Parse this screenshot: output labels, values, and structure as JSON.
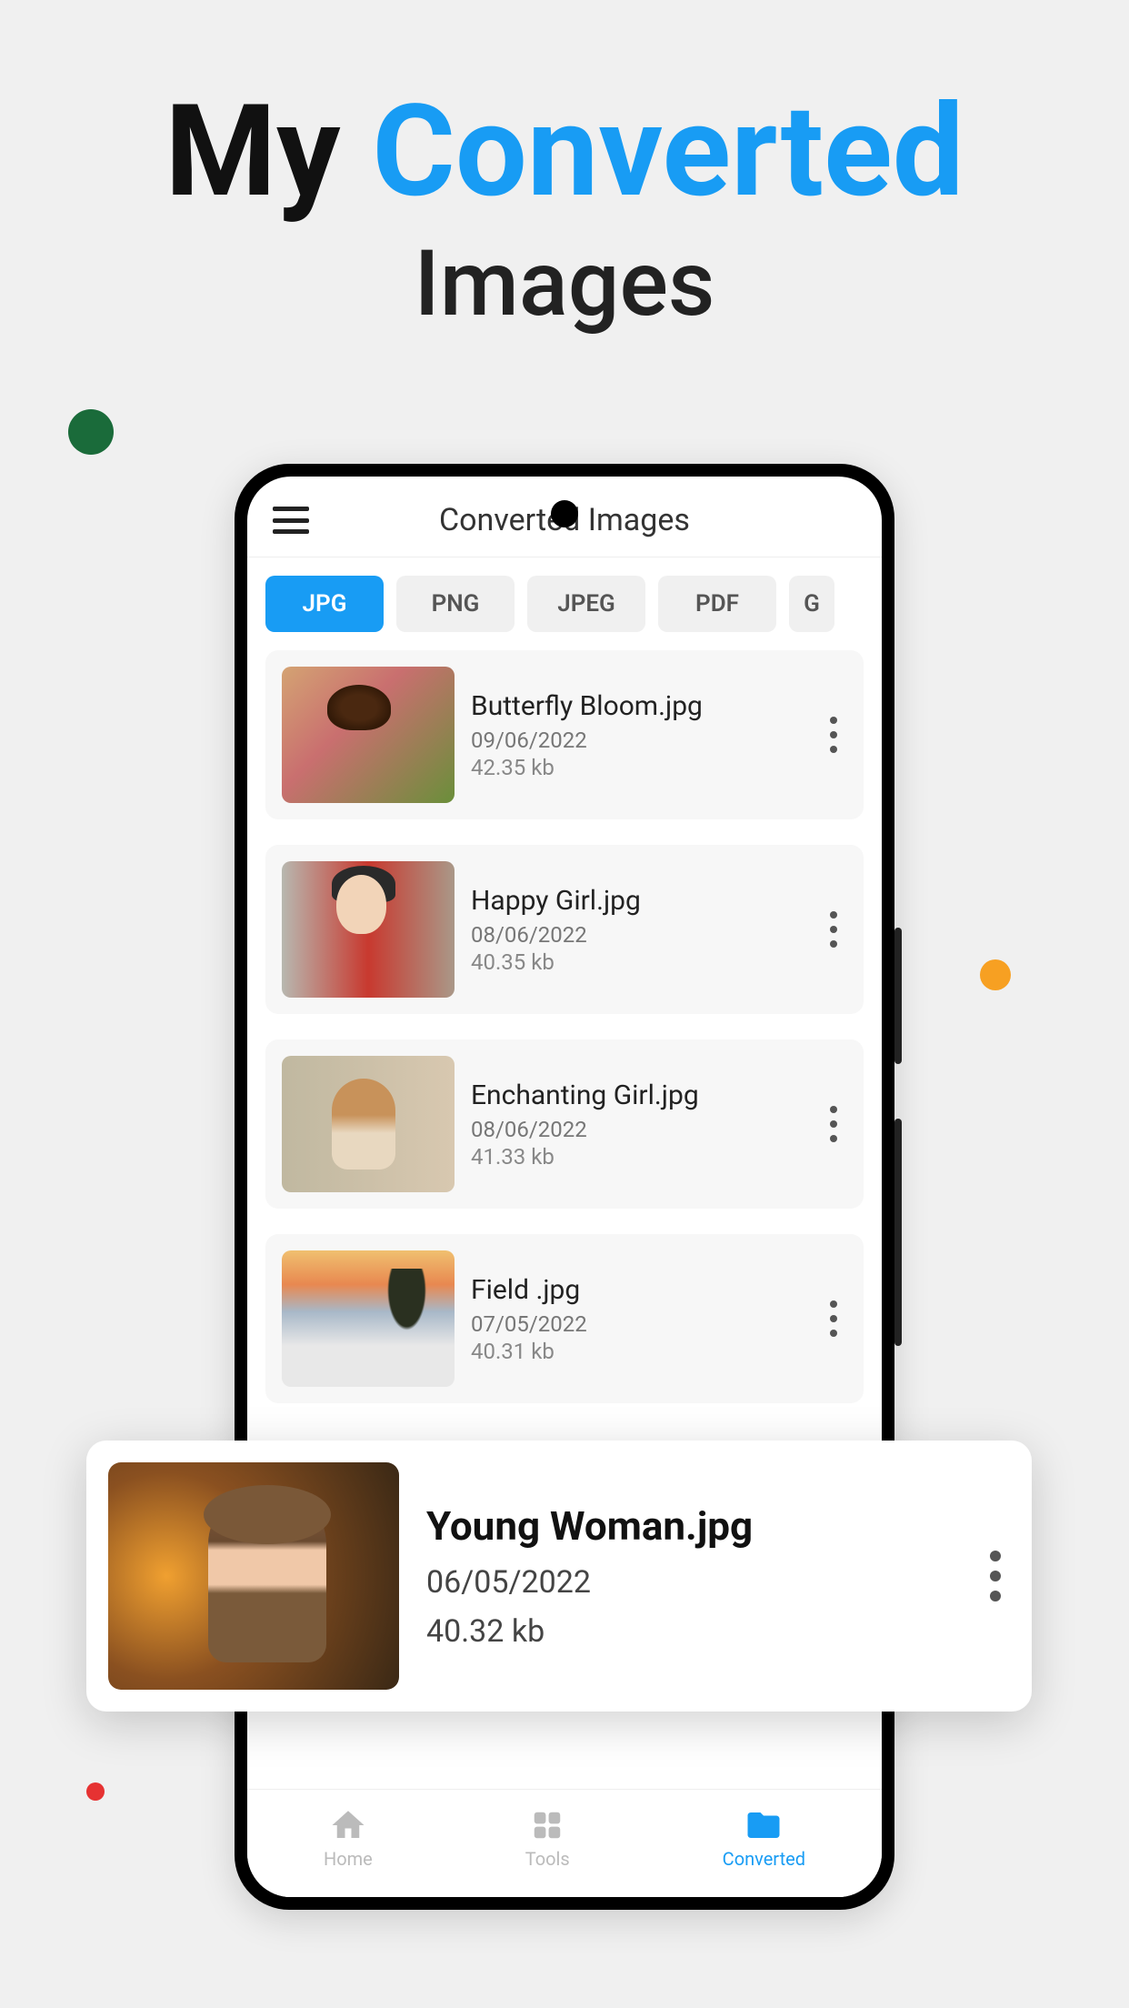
{
  "hero": {
    "word1": "My",
    "word2": "Converted",
    "line2": "Images"
  },
  "app": {
    "title": "Converted Images"
  },
  "filters": [
    {
      "label": "JPG",
      "active": true
    },
    {
      "label": "PNG",
      "active": false
    },
    {
      "label": "JPEG",
      "active": false
    },
    {
      "label": "PDF",
      "active": false
    },
    {
      "label": "G",
      "active": false
    }
  ],
  "files": [
    {
      "name": "Butterfly Bloom.jpg",
      "date": "09/06/2022",
      "size": "42.35 kb",
      "thumb": "butterfly"
    },
    {
      "name": "Happy Girl.jpg",
      "date": "08/06/2022",
      "size": "40.35 kb",
      "thumb": "happy"
    },
    {
      "name": "Enchanting Girl.jpg",
      "date": "08/06/2022",
      "size": "41.33 kb",
      "thumb": "enchanting"
    },
    {
      "name": "Field .jpg",
      "date": "07/05/2022",
      "size": "40.31 kb",
      "thumb": "field"
    }
  ],
  "highlight": {
    "name": "Young Woman.jpg",
    "date": "06/05/2022",
    "size": "40.32 kb"
  },
  "nav": {
    "home": "Home",
    "tools": "Tools",
    "converted": "Converted"
  }
}
